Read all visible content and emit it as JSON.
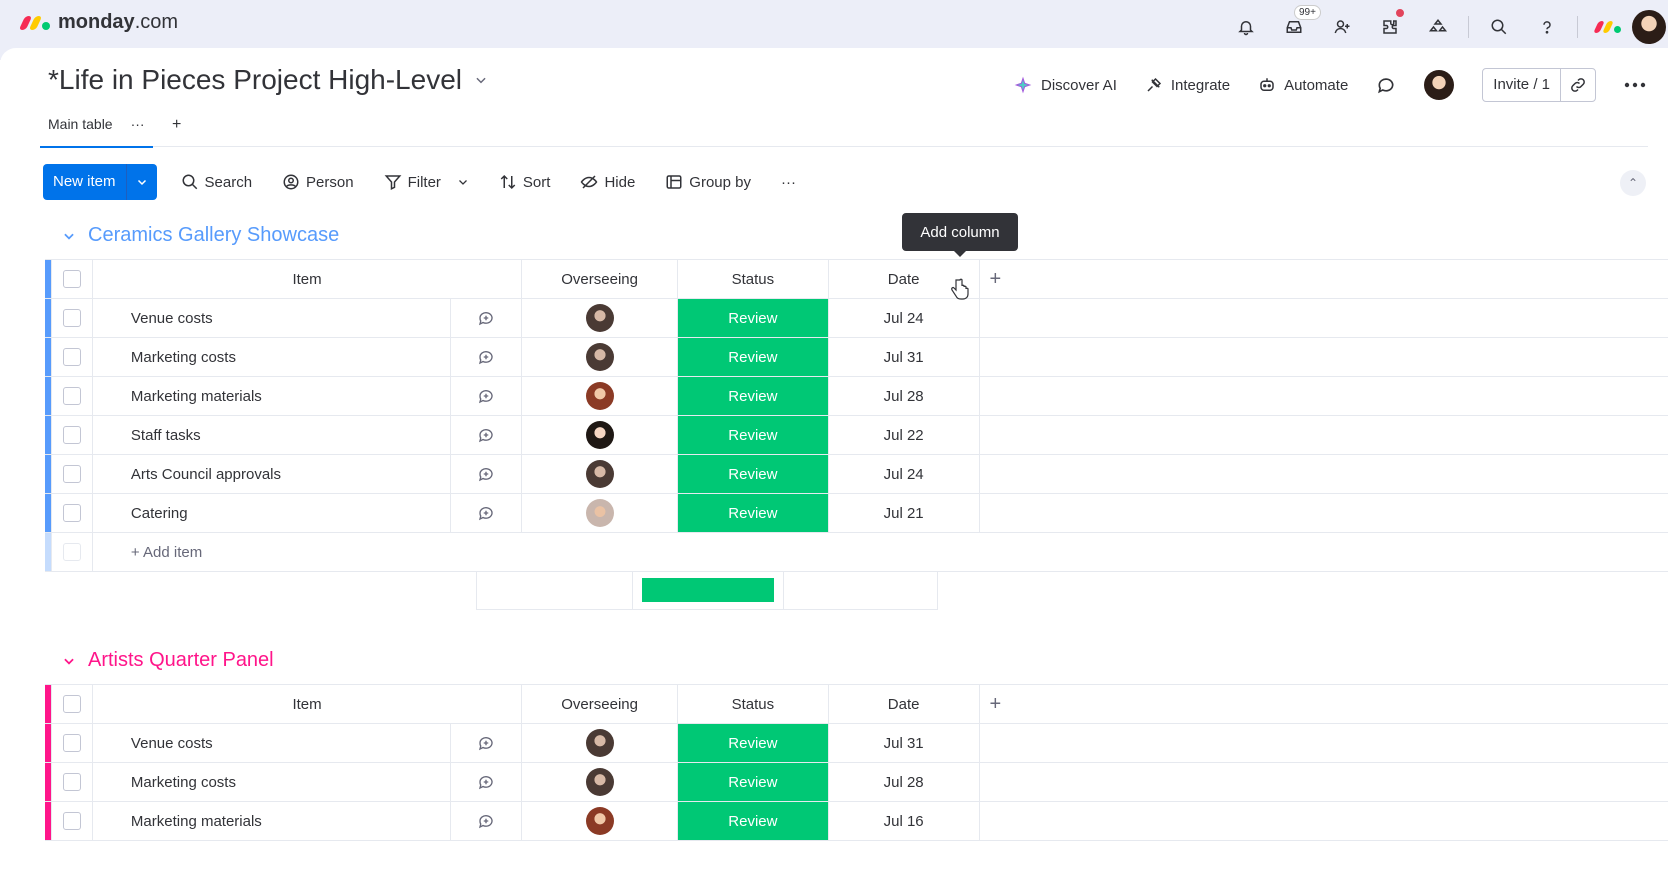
{
  "app": {
    "logo_bold": "monday",
    "logo_rest": ".com",
    "inbox_badge": "99+"
  },
  "board": {
    "title": "*Life in Pieces Project High-Level",
    "actions": {
      "discover_ai": "Discover AI",
      "integrate": "Integrate",
      "automate": "Automate",
      "invite": "Invite / 1"
    }
  },
  "views": {
    "main_tab": "Main table",
    "more": "···",
    "add": "+"
  },
  "toolbar": {
    "new_item": "New item",
    "search": "Search",
    "person": "Person",
    "filter": "Filter",
    "sort": "Sort",
    "hide": "Hide",
    "group_by": "Group by",
    "more": "···"
  },
  "tooltip": "Add column",
  "columns": {
    "item": "Item",
    "owner": "Overseeing",
    "status": "Status",
    "date": "Date",
    "add": "+"
  },
  "groups": [
    {
      "title": "Ceramics Gallery Showcase",
      "color": "#579bfc",
      "add_item": "+ Add item",
      "rows": [
        {
          "item": "Venue costs",
          "status": "Review",
          "date": "Jul 24"
        },
        {
          "item": "Marketing costs",
          "status": "Review",
          "date": "Jul 31"
        },
        {
          "item": "Marketing materials",
          "status": "Review",
          "date": "Jul 28"
        },
        {
          "item": "Staff tasks",
          "status": "Review",
          "date": "Jul 22"
        },
        {
          "item": "Arts Council approvals",
          "status": "Review",
          "date": "Jul 24"
        },
        {
          "item": "Catering",
          "status": "Review",
          "date": "Jul 21"
        }
      ]
    },
    {
      "title": "Artists Quarter Panel",
      "color": "#ff158a",
      "rows": [
        {
          "item": "Venue costs",
          "status": "Review",
          "date": "Jul 31"
        },
        {
          "item": "Marketing costs",
          "status": "Review",
          "date": "Jul 28"
        },
        {
          "item": "Marketing materials",
          "status": "Review",
          "date": "Jul 16"
        }
      ]
    }
  ],
  "colors": {
    "status_review": "#00c875",
    "primary": "#0073ea"
  }
}
